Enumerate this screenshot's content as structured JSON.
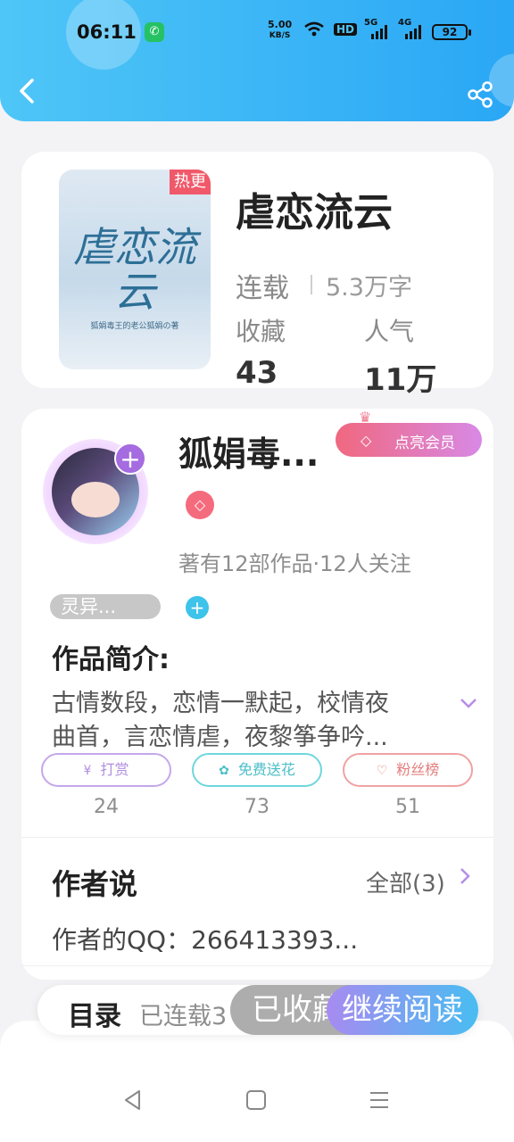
{
  "status_bar": {
    "time": "06:11",
    "net_speed_value": "5.00",
    "net_speed_unit": "KB/S",
    "hd_label": "HD",
    "sim1": "5G",
    "sim2": "4G",
    "battery": "92"
  },
  "book": {
    "cover_title": "虐恋流云",
    "cover_author": "狐娟毒王的老公狐娟の著",
    "hot_tag": "热更",
    "title": "虐恋流云",
    "status": "连载",
    "word_count": "5.3万字",
    "collect_label": "收藏",
    "collect_value": "43",
    "popularity_label": "人气",
    "popularity_value": "11万"
  },
  "author": {
    "name": "狐娟毒...",
    "vip_button": "点亮会员",
    "meta": "著有12部作品·12人关注",
    "genre_tag": "灵异...",
    "intro_title": "作品简介:",
    "intro_line1": "古情数段，恋情一默起，校情夜",
    "intro_line2": "曲首，言恋情虐，夜黎筝争吟..."
  },
  "actions": {
    "reward": {
      "label": "打赏",
      "count": "24"
    },
    "flower": {
      "label": "免费送花",
      "count": "73"
    },
    "fans": {
      "label": "粉丝榜",
      "count": "51"
    }
  },
  "author_says": {
    "title": "作者说",
    "all_label": "全部(3)",
    "text": "作者的QQ：266413393..."
  },
  "bottom_bar": {
    "toc_label": "目录",
    "toc_status": "已连载3",
    "collected_label": "已收藏",
    "read_label": "继续阅读"
  },
  "icons": {
    "back": "back-arrow-icon",
    "share": "share-icon",
    "nav_back": "nav-back-icon",
    "nav_home": "nav-home-icon",
    "nav_menu": "nav-menu-icon"
  },
  "colors": {
    "header": "#2aa7f5",
    "accent_purple": "#a56be0",
    "vip_gradient_start": "#f0687f",
    "read_gradient_end": "#48bdf2"
  }
}
